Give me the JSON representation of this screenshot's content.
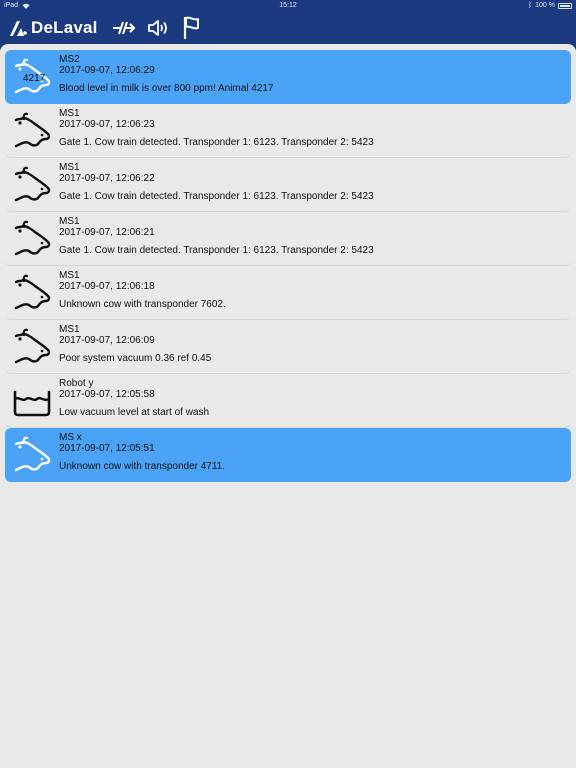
{
  "status_bar": {
    "device": "iPad",
    "time": "15:12",
    "battery": "100 %"
  },
  "nav": {
    "brand": "DeLaval",
    "icons": [
      "logo-icon",
      "connection-icon",
      "speaker-icon",
      "flag-icon"
    ]
  },
  "colors": {
    "nav_bg": "#1b3a80",
    "selected_row": "#4aa3f7",
    "content_bg": "#e9e9e9"
  },
  "alarms": [
    {
      "source": "MS2",
      "time": "2017-09-07, 12:06:29",
      "message": "Blood level in milk is over 800 ppm! Animal 4217",
      "icon": "cow-icon",
      "tag": "4217",
      "selected": true
    },
    {
      "source": "MS1",
      "time": "2017-09-07, 12:06:23",
      "message": "Gate 1. Cow train detected. Transponder 1: 6123. Transponder 2: 5423",
      "icon": "cow-icon",
      "tag": "",
      "selected": false
    },
    {
      "source": "MS1",
      "time": "2017-09-07, 12:06:22",
      "message": "Gate 1. Cow train detected. Transponder 1: 6123. Transponder 2: 5423",
      "icon": "cow-icon",
      "tag": "",
      "selected": false
    },
    {
      "source": "MS1",
      "time": "2017-09-07, 12:06:21",
      "message": "Gate 1. Cow train detected. Transponder 1: 6123. Transponder 2: 5423",
      "icon": "cow-icon",
      "tag": "",
      "selected": false
    },
    {
      "source": "MS1",
      "time": "2017-09-07, 12:06:18",
      "message": "Unknown cow with transponder 7602.",
      "icon": "cow-icon",
      "tag": "",
      "selected": false
    },
    {
      "source": "MS1",
      "time": "2017-09-07, 12:06:09",
      "message": "Poor system vacuum 0.36 ref 0.45",
      "icon": "cow-icon",
      "tag": "",
      "selected": false
    },
    {
      "source": "Robot y",
      "time": "2017-09-07, 12:05:58",
      "message": "Low vacuum level at start of wash",
      "icon": "wash-tub-icon",
      "tag": "",
      "selected": false
    },
    {
      "source": "MS x",
      "time": "2017-09-07, 12:05:51",
      "message": "Unknown cow with transponder 4711.",
      "icon": "cow-icon",
      "tag": "",
      "selected": true
    }
  ]
}
